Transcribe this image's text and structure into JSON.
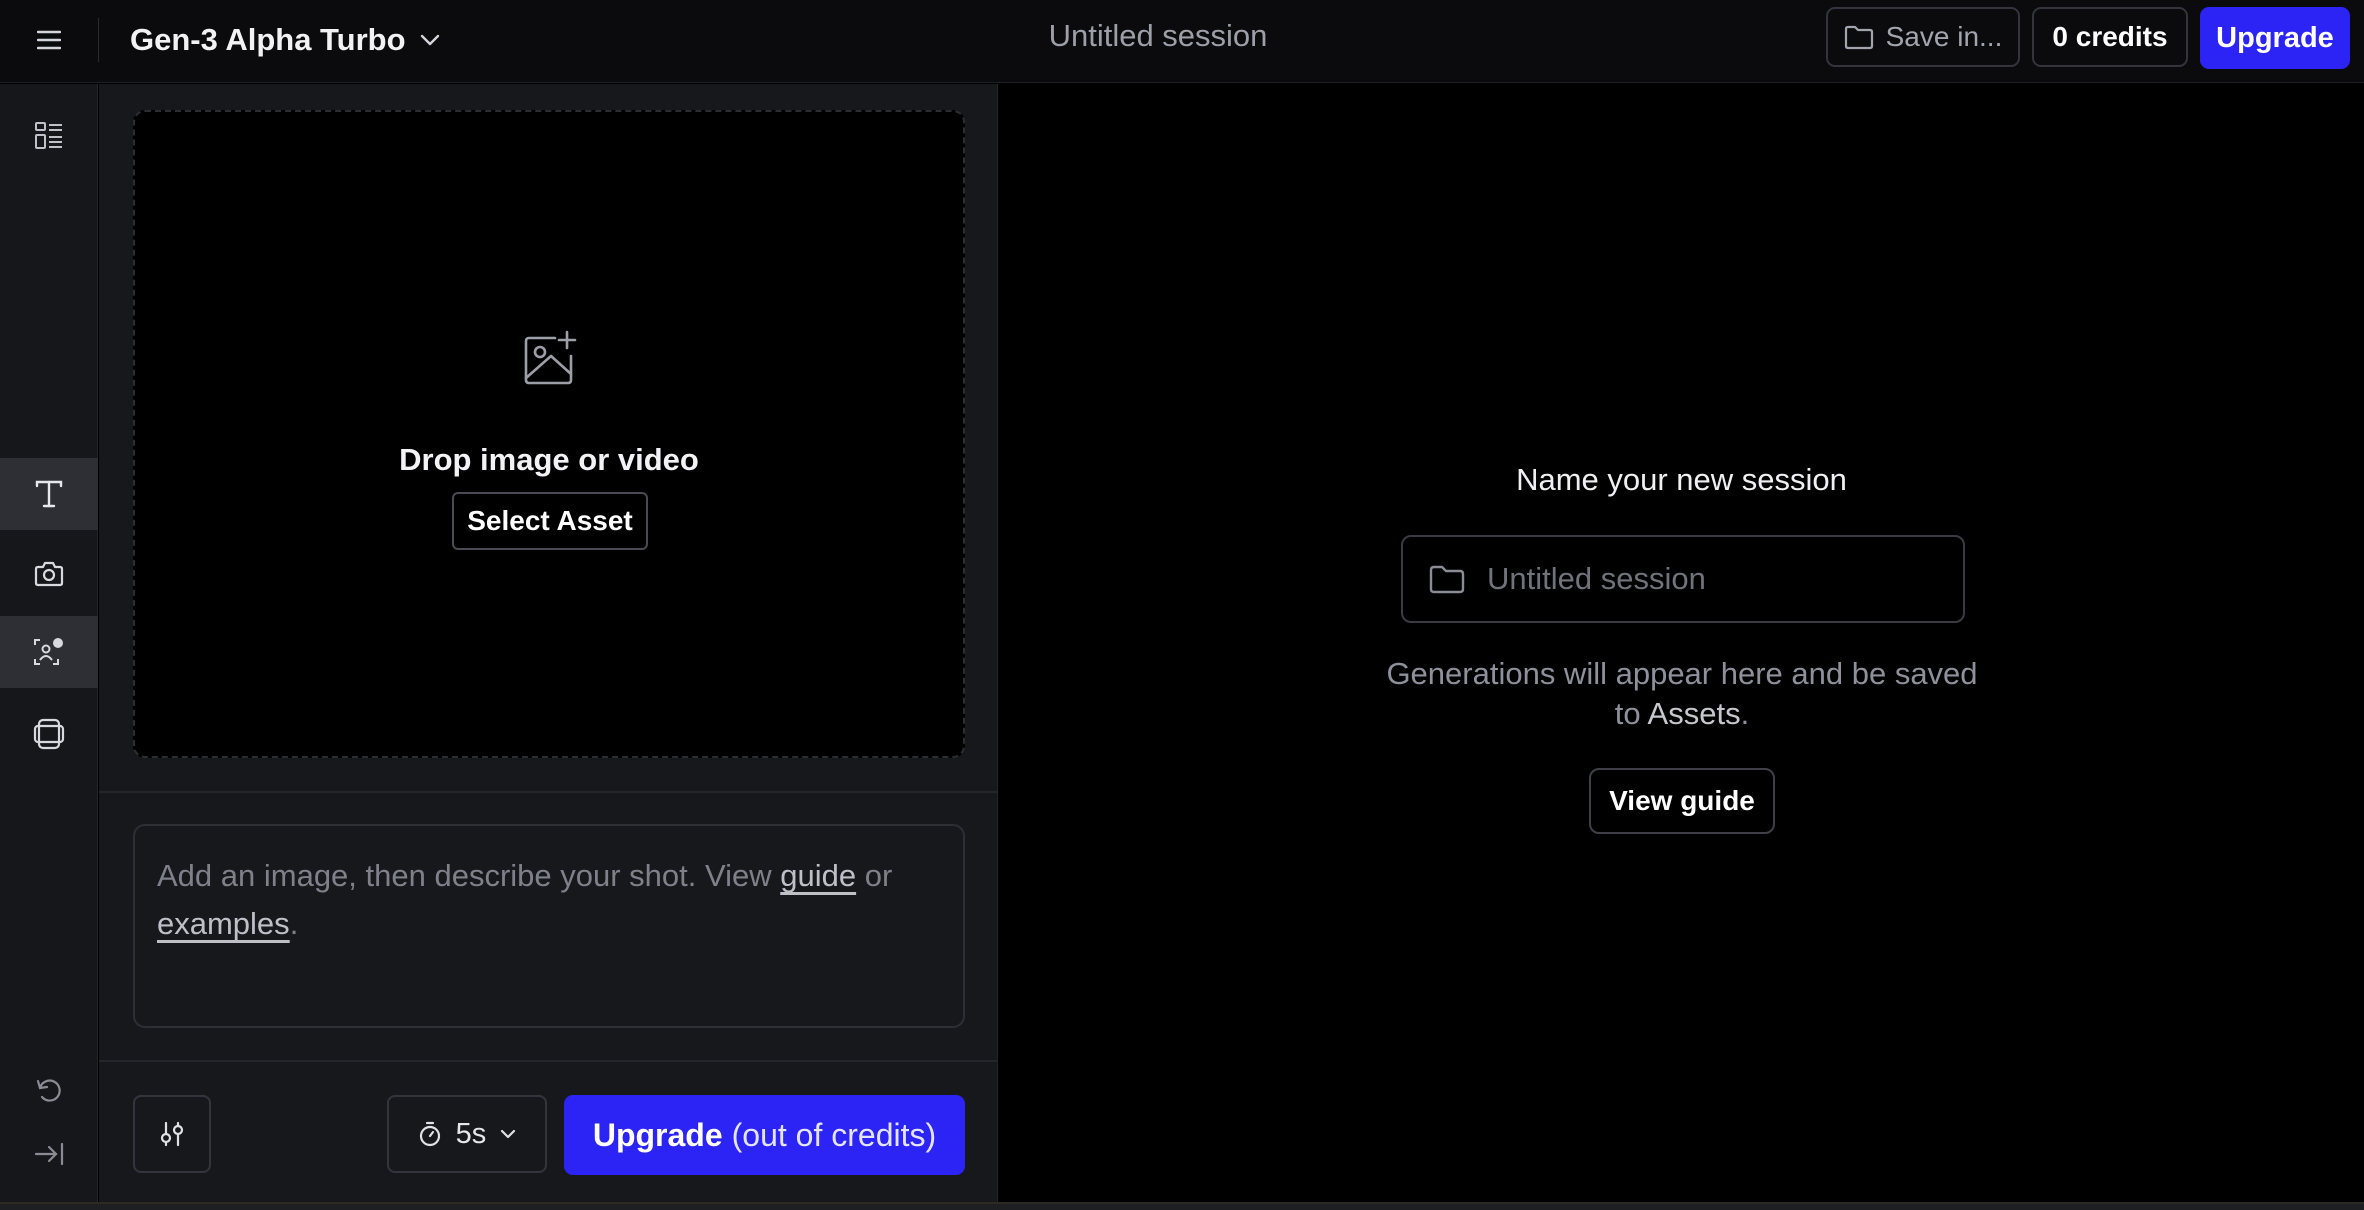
{
  "topbar": {
    "model_name": "Gen-3 Alpha Turbo",
    "session_title": "Untitled session",
    "save_label": "Save in...",
    "credits_label": "0 credits",
    "upgrade_label": "Upgrade"
  },
  "rail": {
    "items": [
      {
        "icon": "layout-list-icon"
      },
      {
        "icon": "text-icon",
        "active": true
      },
      {
        "icon": "camera-icon"
      },
      {
        "icon": "face-tracking-icon",
        "active": true
      },
      {
        "icon": "layers-icon"
      },
      {
        "icon": "undo-icon"
      },
      {
        "icon": "collapse-panel-icon"
      }
    ]
  },
  "dropzone": {
    "icon": "image-add-icon",
    "text": "Drop image or video",
    "select_label": "Select Asset"
  },
  "prompt": {
    "text_before": "Add an image, then describe your shot. View ",
    "guide_link": "guide",
    "text_middle": " or ",
    "examples_link": "examples",
    "text_after": "."
  },
  "controls": {
    "duration": "5s",
    "upgrade_main": "Upgrade",
    "upgrade_sub": "(out of credits)"
  },
  "main": {
    "heading": "Name your new session",
    "session_placeholder": "Untitled session",
    "gen_text_before": "Generations will appear here and be saved to ",
    "gen_text_assets": "Assets",
    "gen_text_after": ".",
    "view_guide_label": "View guide"
  },
  "colors": {
    "accent": "#2b24f5",
    "background": "#000000",
    "panel": "#17181c"
  }
}
